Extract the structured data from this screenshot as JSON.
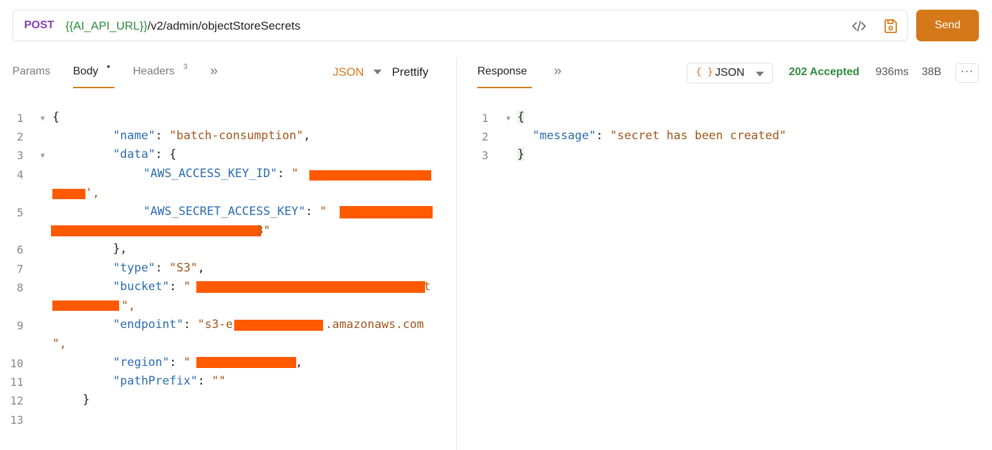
{
  "request": {
    "method": "POST",
    "url_var": "{{AI_API_URL}}",
    "url_path": "/v2/admin/objectStoreSecrets",
    "send_label": "Send"
  },
  "tabs": {
    "params": "Params",
    "body": "Body",
    "body_dot": "•",
    "headers": "Headers",
    "headers_count": "3",
    "more": "»"
  },
  "body_format": {
    "lang": "JSON",
    "prettify": "Prettify"
  },
  "response": {
    "tab": "Response",
    "more": "»",
    "format_braces": "{ }",
    "format": "JSON",
    "status": "202 Accepted",
    "time": "936ms",
    "size": "38B",
    "menu": "···"
  },
  "request_body": {
    "line_numbers": [
      "1",
      "2",
      "3",
      "4",
      "5",
      "6",
      "7",
      "8",
      "9",
      "10",
      "11",
      "12",
      "13"
    ],
    "l1": "{",
    "l2_key": "\"name\"",
    "l2_sep": ": ",
    "l2_val": "\"batch-consumption\"",
    "l2_end": ",",
    "l3_key": "\"data\"",
    "l3_rest": ": {",
    "l4_key": "\"AWS_ACCESS_KEY_ID\"",
    "l4_sep": ": ",
    "l4_q": "\"",
    "l4b_end": "',",
    "l5_key": "\"AWS_SECRET_ACCESS_KEY\"",
    "l5_sep": ": ",
    "l5_q": "\"",
    "l5b_end": "3\"",
    "l6": "},",
    "l7_key": "\"type\"",
    "l7_sep": ": ",
    "l7_val": "\"S3\"",
    "l7_end": ",",
    "l8_key": "\"bucket\"",
    "l8_sep": ": ",
    "l8_q": "\"",
    "l8_tail": "t",
    "l8b_end": "\",",
    "l9_key": "\"endpoint\"",
    "l9_sep": ": ",
    "l9_pre": "\"s3-e",
    "l9_post": ".amazonaws.com",
    "l9b_end": "\",",
    "l10_key": "\"region\"",
    "l10_sep": ": ",
    "l10_q": "\"",
    "l10_end": ",",
    "l11_key": "\"pathPrefix\"",
    "l11_sep": ": ",
    "l11_val": "\"\"",
    "l12": "}"
  },
  "response_body": {
    "line_numbers": [
      "1",
      "2",
      "3"
    ],
    "l1": "{",
    "l2_key": "\"message\"",
    "l2_sep": ": ",
    "l2_val": "\"secret has been created\"",
    "l3": "}"
  },
  "colors": {
    "accent": "#d4781a",
    "method": "#8b3dad",
    "variable": "#2e8a3f",
    "status_ok": "#2e8a3f",
    "json_key": "#2b6cb0",
    "json_string": "#a3551c",
    "redaction": "#ff5a00"
  }
}
